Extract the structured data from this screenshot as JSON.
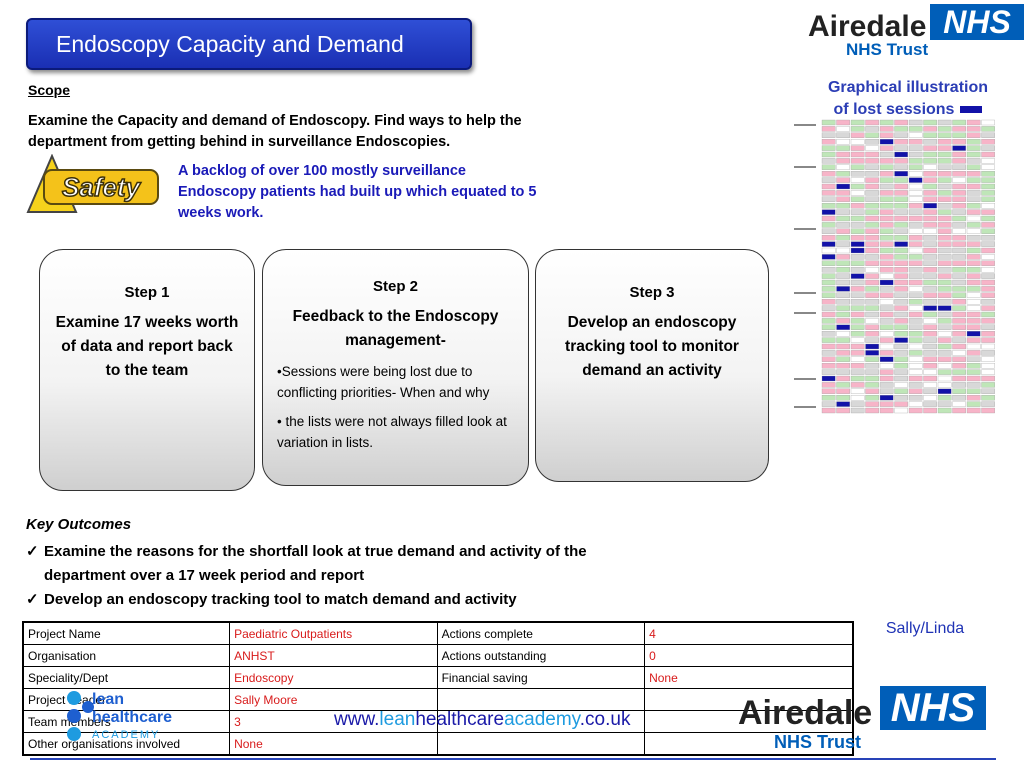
{
  "header": {
    "title": "Endoscopy Capacity and Demand"
  },
  "logo_top": {
    "name": "Airedale",
    "nhs": "NHS",
    "trust": "NHS Trust"
  },
  "scope": {
    "heading": "Scope",
    "text": "Examine the Capacity and demand of Endoscopy. Find ways to help the department from getting behind in surveillance Endoscopies."
  },
  "safety": {
    "badge": "Safety",
    "note": "A backlog of over 100 mostly surveillance Endoscopy patients had built up which equated to 5 weeks work."
  },
  "graph": {
    "caption": "Graphical illustration of lost sessions"
  },
  "steps": [
    {
      "heading": "Step 1",
      "body": "Examine 17 weeks worth of data and report back to the team"
    },
    {
      "heading": "Step 2",
      "body": "Feedback to the Endoscopy management-",
      "bullets": [
        "•Sessions were being lost due to conflicting priorities- When and why",
        "• the lists were not always filled look at variation in lists."
      ]
    },
    {
      "heading": "Step 3",
      "body": "Develop an endoscopy tracking tool to monitor demand an activity"
    }
  ],
  "outcomes": {
    "heading": "Key Outcomes",
    "check": "✓",
    "items": [
      "Examine the reasons for the shortfall look at true demand and activity of the department over a 17 week period and report",
      "Develop an endoscopy tracking tool to match demand and activity"
    ]
  },
  "signature": "Sally/Linda",
  "table": {
    "rows": [
      [
        "Project Name",
        "Paediatric Outpatients",
        "Actions complete",
        "4"
      ],
      [
        "Organisation",
        "ANHST",
        "Actions outstanding",
        "0"
      ],
      [
        "Speciality/Dept",
        "Endoscopy",
        "Financial saving",
        "None"
      ],
      [
        "Project Leader",
        "Sally Moore",
        "",
        ""
      ],
      [
        "Team members",
        "3",
        "",
        ""
      ],
      [
        "Other organisations involved",
        "None",
        "",
        ""
      ]
    ]
  },
  "lean_logo": {
    "line1": "lean",
    "line2": "healthcare",
    "line3": "ACADEMY"
  },
  "url": {
    "prefix": "www.",
    "lean": "lean",
    "healthcare": "healthcare",
    "academy": "academy",
    "suffix": ".co.uk"
  },
  "logo_bottom": {
    "name": "Airedale",
    "nhs": "NHS",
    "trust": "NHS Trust"
  },
  "colors": {
    "banner_blue": "#1a2fb3",
    "nhs_blue": "#005eb8",
    "value_red": "#d81b1b",
    "caption_blue": "#2b3db5"
  }
}
